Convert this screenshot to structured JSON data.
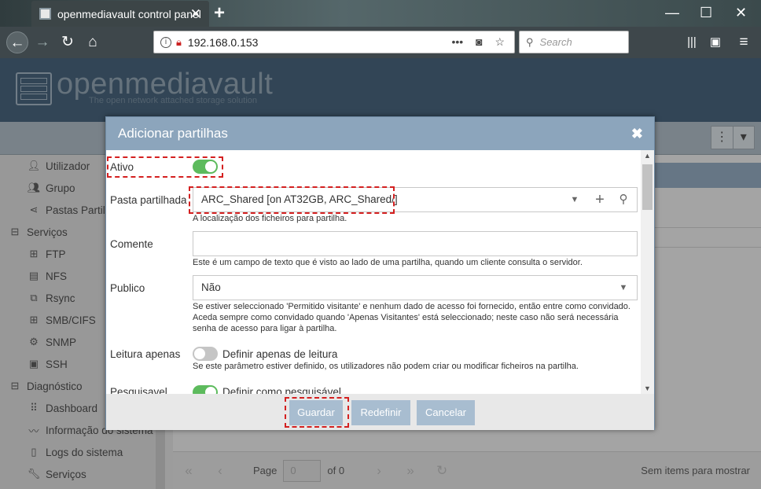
{
  "browser": {
    "tab_title": "openmediavault control panel",
    "tab_close": "✕",
    "new_tab": "+",
    "url": "192.168.0.153",
    "url_more": "•••",
    "search_placeholder": "Search",
    "window_controls": [
      "—",
      "☐",
      "✕"
    ]
  },
  "omv": {
    "logo_text": "openmediavault",
    "tagline": "The open network attached storage solution"
  },
  "sidebar": {
    "items": [
      {
        "label": "Utilizador",
        "icon": "user-icon"
      },
      {
        "label": "Grupo",
        "icon": "group-icon"
      },
      {
        "label": "Pastas Partilhadas",
        "icon": "share-icon"
      },
      {
        "label": "Serviços",
        "icon": "minus-square-icon"
      },
      {
        "label": "FTP",
        "icon": "ftp-icon"
      },
      {
        "label": "NFS",
        "icon": "nfs-icon"
      },
      {
        "label": "Rsync",
        "icon": "rsync-icon"
      },
      {
        "label": "SMB/CIFS",
        "icon": "windows-icon"
      },
      {
        "label": "SNMP",
        "icon": "snmp-icon"
      },
      {
        "label": "SSH",
        "icon": "terminal-icon"
      },
      {
        "label": "Diagnóstico",
        "icon": "minus-square-icon"
      },
      {
        "label": "Dashboard",
        "icon": "grid-icon"
      },
      {
        "label": "Informação do sistema",
        "icon": "chart-icon"
      },
      {
        "label": "Logs do sistema",
        "icon": "file-icon"
      },
      {
        "label": "Serviços",
        "icon": "wrench-icon"
      }
    ]
  },
  "pager": {
    "page_label": "Page",
    "page_value": "0",
    "of_label": "of 0",
    "no_items": "Sem items para mostrar"
  },
  "dialog": {
    "title": "Adicionar partilhas",
    "close": "✖",
    "fields": {
      "ativo_label": "Ativo",
      "pasta_label": "Pasta partilhada",
      "pasta_value": "ARC_Shared [on AT32GB, ARC_Shared/]",
      "pasta_help": "A localização dos ficheiros para partilha.",
      "comente_label": "Comente",
      "comente_value": "",
      "comente_help": "Este é um campo de texto que é visto ao lado de uma partilha, quando um cliente consulta o servidor.",
      "publico_label": "Publico",
      "publico_value": "Não",
      "publico_help": "Se estiver seleccionado 'Permitido visitante' e nenhum dado de acesso foi fornecido, então entre como convidado. Aceda sempre como convidado quando 'Apenas Visitantes' está seleccionado; neste caso não será necessária senha de acesso para ligar à partilha.",
      "leitura_label": "Leitura apenas",
      "leitura_toggle_label": "Definir apenas de leitura",
      "leitura_help": "Se este parâmetro estiver definido, os utilizadores não podem criar ou modificar ficheiros na partilha.",
      "pesquisavel_label": "Pesquisavel",
      "pesquisavel_toggle_label": "Definir como pesquisável"
    },
    "toggles": {
      "ativo": true,
      "leitura": false,
      "pesquisavel": true
    },
    "buttons": {
      "save": "Guardar",
      "reset": "Redefinir",
      "cancel": "Cancelar"
    }
  }
}
